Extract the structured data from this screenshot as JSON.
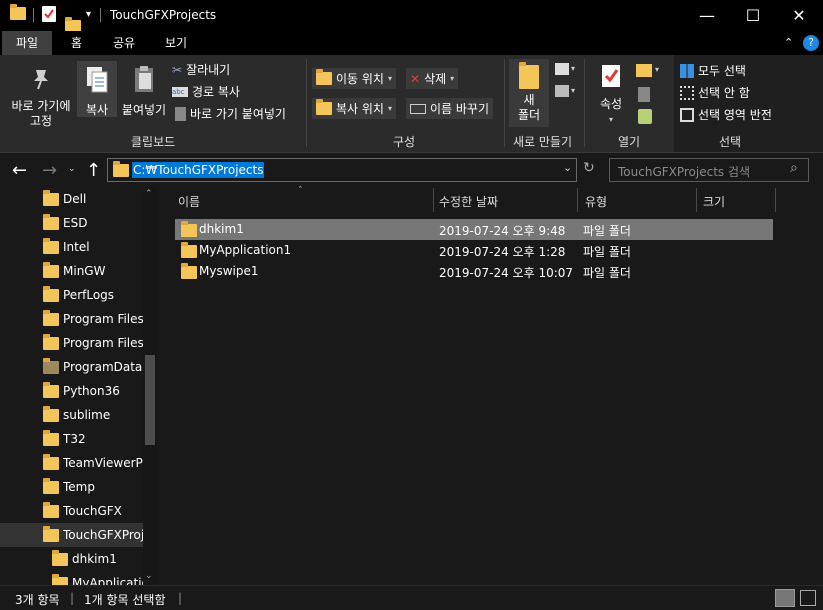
{
  "window": {
    "title": "TouchGFXProjects"
  },
  "menu": {
    "tabs": [
      "파일",
      "홈",
      "공유",
      "보기"
    ]
  },
  "ribbon": {
    "pin": "바로 가기에\n고정",
    "copy": "복사",
    "paste": "붙여넣기",
    "cut": "잘라내기",
    "copy_path": "경로 복사",
    "paste_shortcut": "바로 가기 붙여넣기",
    "clipboard_group": "클립보드",
    "move_to": "이동 위치",
    "copy_to": "복사 위치",
    "delete": "삭제",
    "rename": "이름 바꾸기",
    "organize_group": "구성",
    "new_folder": "새\n폴더",
    "new_group": "새로 만들기",
    "properties": "속성",
    "open_group": "열기",
    "select_all": "모두 선택",
    "select_none": "선택 안 함",
    "invert_selection": "선택 영역 반전",
    "select_group": "선택"
  },
  "address": {
    "path": "C:₩TouchGFXProjects",
    "search_placeholder": "TouchGFXProjects 검색"
  },
  "tree": {
    "items": [
      {
        "label": "Dell"
      },
      {
        "label": "ESD"
      },
      {
        "label": "Intel"
      },
      {
        "label": "MinGW"
      },
      {
        "label": "PerfLogs"
      },
      {
        "label": "Program Files"
      },
      {
        "label": "Program Files"
      },
      {
        "label": "ProgramData"
      },
      {
        "label": "Python36"
      },
      {
        "label": "sublime"
      },
      {
        "label": "T32"
      },
      {
        "label": "TeamViewerPo"
      },
      {
        "label": "Temp"
      },
      {
        "label": "TouchGFX"
      },
      {
        "label": "TouchGFXProje"
      },
      {
        "label": "dhkim1"
      },
      {
        "label": "MyApplicatio"
      }
    ]
  },
  "columns": {
    "name": "이름",
    "modified": "수정한 날짜",
    "type": "유형",
    "size": "크기"
  },
  "files": [
    {
      "name": "dhkim1",
      "modified": "2019-07-24 오후 9:48",
      "type": "파일 폴더"
    },
    {
      "name": "MyApplication1",
      "modified": "2019-07-24 오후 1:28",
      "type": "파일 폴더"
    },
    {
      "name": "Myswipe1",
      "modified": "2019-07-24 오후 10:07",
      "type": "파일 폴더"
    }
  ],
  "status": {
    "count": "3개 항목",
    "selected": "1개 항목 선택함"
  },
  "colors": {
    "accent": "#0078d7",
    "folder": "#f4c65a",
    "selected_row": "#777777"
  }
}
